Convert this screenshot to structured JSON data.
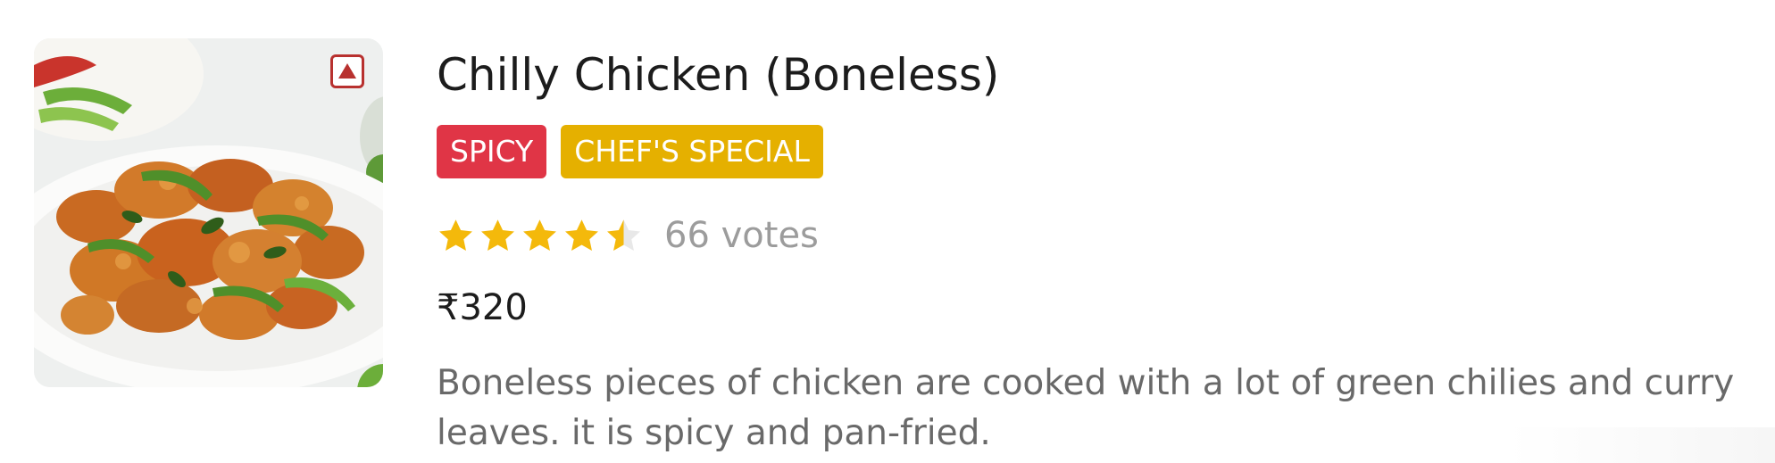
{
  "item": {
    "name": "Chilly Chicken (Boneless)",
    "image_icon": "food-photo-chilly-chicken",
    "diet_icon": "non-veg-icon",
    "tags": [
      {
        "label": "SPICY",
        "color": "#e03546"
      },
      {
        "label": "CHEF'S SPECIAL",
        "color": "#e5b000"
      }
    ],
    "rating": {
      "stars": 4.5,
      "max_stars": 5,
      "votes_label": "66 votes"
    },
    "price": "₹320",
    "description": "Boneless pieces of chicken are cooked with a lot of green chilies and curry leaves. it is spicy and pan-fried."
  },
  "colors": {
    "star_fill": "#f4b90b",
    "star_empty": "#e8e8e8",
    "non_veg": "#b8312f"
  }
}
